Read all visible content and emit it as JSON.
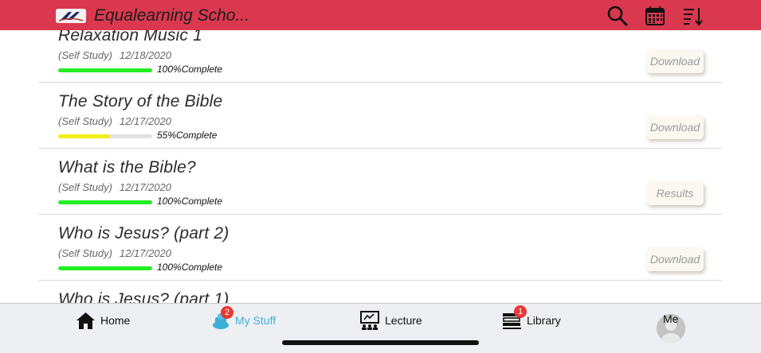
{
  "header": {
    "title": "Equalearning Scho...",
    "icons": [
      "app-logo",
      "search-icon",
      "calendar-icon",
      "sort-icon"
    ],
    "background": "#d9384e"
  },
  "items": [
    {
      "title": "Relaxation Music 1",
      "type": "(Self Study)",
      "date": "12/18/2020",
      "progress": 100,
      "progress_text": "100%Complete",
      "bar_color": "#22ee22",
      "action": "Download"
    },
    {
      "title": "The Story of the Bible",
      "type": "(Self Study)",
      "date": "12/17/2020",
      "progress": 55,
      "progress_text": "55%Complete",
      "bar_color": "#f2ee1a",
      "action": "Download"
    },
    {
      "title": "What is the Bible?",
      "type": "(Self Study)",
      "date": "12/17/2020",
      "progress": 100,
      "progress_text": "100%Complete",
      "bar_color": "#22ee22",
      "action": "Results"
    },
    {
      "title": "Who is Jesus? (part 2)",
      "type": "(Self Study)",
      "date": "12/17/2020",
      "progress": 100,
      "progress_text": "100%Complete",
      "bar_color": "#22ee22",
      "action": "Download"
    },
    {
      "title": "Who is Jesus? (part 1)"
    }
  ],
  "tabbar": {
    "tabs": [
      {
        "label": "Home",
        "icon": "home-icon"
      },
      {
        "label": "My Stuff",
        "icon": "my-stuff-icon",
        "badge": "2",
        "active": true
      },
      {
        "label": "Lecture",
        "icon": "lecture-icon"
      },
      {
        "label": "Library",
        "icon": "library-icon",
        "badge": "1"
      },
      {
        "label": "Me",
        "icon": "avatar"
      }
    ],
    "active_color": "#3ab0d8",
    "badge_color": "#e53935"
  }
}
